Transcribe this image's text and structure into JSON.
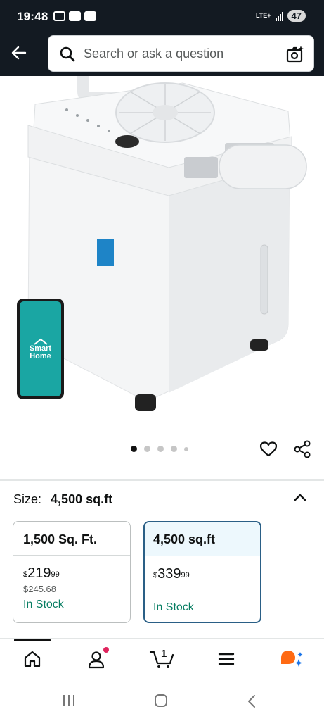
{
  "status_bar": {
    "time": "19:48",
    "network": "LTE+",
    "battery": "47"
  },
  "search": {
    "placeholder": "Search or ask a question"
  },
  "gallery": {
    "phone_label": "Smart Home",
    "dot_count": 5,
    "active_dot": 1
  },
  "size": {
    "label": "Size:",
    "value": "4,500 sq.ft",
    "options": [
      {
        "name": "1,500 Sq. Ft.",
        "price_symbol": "$",
        "price_whole": "219",
        "price_fraction": "99",
        "list_price": "$245.68",
        "stock": "In Stock",
        "selected": false
      },
      {
        "name": "4,500 sq.ft",
        "price_symbol": "$",
        "price_whole": "339",
        "price_fraction": "99",
        "stock": "In Stock",
        "selected": true
      }
    ]
  },
  "bottom_nav": {
    "items": [
      "home-icon",
      "account-icon",
      "cart-icon",
      "menu-icon",
      "rufus-icon"
    ],
    "cart_count": "1"
  },
  "colors": {
    "header_bg": "#131a22",
    "stock_green": "#067d62",
    "selected_border": "#2a5f86",
    "phone_teal": "#1aa6a3"
  }
}
